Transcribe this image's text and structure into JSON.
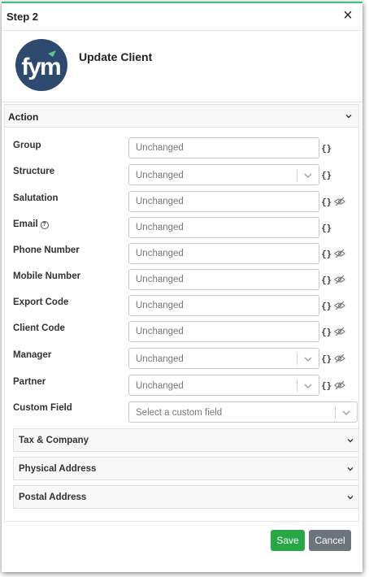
{
  "dialog": {
    "title": "Step 2",
    "close_label": "×"
  },
  "action_info": {
    "logo_icon": "fym-logo-icon",
    "title": "Update Client"
  },
  "action_card": {
    "title": "Action",
    "fields": {
      "group": {
        "label": "Group",
        "placeholder": "Unchanged"
      },
      "structure": {
        "label": "Structure",
        "value": "Unchanged"
      },
      "salutation": {
        "label": "Salutation",
        "placeholder": "Unchanged"
      },
      "email": {
        "label": "Email",
        "placeholder": "Unchanged",
        "help": "?"
      },
      "phone_number": {
        "label": "Phone Number",
        "placeholder": "Unchanged"
      },
      "mobile_number": {
        "label": "Mobile Number",
        "placeholder": "Unchanged"
      },
      "export_code": {
        "label": "Export Code",
        "placeholder": "Unchanged"
      },
      "client_code": {
        "label": "Client Code",
        "placeholder": "Unchanged"
      },
      "manager": {
        "label": "Manager",
        "value": "Unchanged"
      },
      "partner": {
        "label": "Partner",
        "value": "Unchanged"
      },
      "custom_field": {
        "label": "Custom Field",
        "placeholder": "Select a custom field"
      }
    },
    "token_label": "{}",
    "sub_panels": [
      "Tax & Company",
      "Physical Address",
      "Postal Address"
    ]
  },
  "footer": {
    "save_label": "Save",
    "cancel_label": "Cancel"
  },
  "colors": {
    "accent": "#3ec47e",
    "save": "#28a745",
    "cancel": "#6c757d",
    "logo_bg": "#2e4a6e",
    "logo_leaf": "#5cc98a"
  }
}
